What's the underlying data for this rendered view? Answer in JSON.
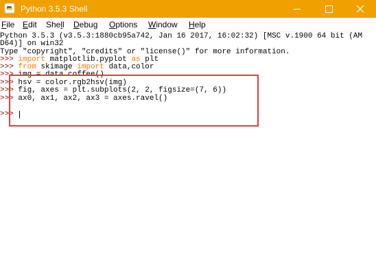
{
  "window": {
    "title": "Python 3.5.3 Shell",
    "accent_color": "#f0a000",
    "icons": [
      "python-icon",
      "minimize-icon",
      "maximize-icon",
      "close-icon"
    ]
  },
  "menu": {
    "file": {
      "u": "F",
      "rest": "ile"
    },
    "edit": {
      "u": "E",
      "rest": "dit"
    },
    "shell": {
      "pre": "She",
      "u": "l",
      "rest": "l"
    },
    "debug": {
      "u": "D",
      "rest": "ebug"
    },
    "options": {
      "u": "O",
      "rest": "ptions"
    },
    "window": {
      "u": "W",
      "rest": "indow"
    },
    "help": {
      "u": "H",
      "rest": "elp"
    }
  },
  "shell": {
    "banner1": "Python 3.5.3 (v3.5.3:1880cb95a742, Jan 16 2017, 16:02:32) [MSC v.1900 64 bit (AM",
    "banner2": "D64)] on win32",
    "banner3": "Type \"copyright\", \"credits\" or \"license()\" for more information.",
    "prompt": ">>> ",
    "cmd1_kw1": "import",
    "cmd1_rest1": " matplotlib.pyplot ",
    "cmd1_kw2": "as",
    "cmd1_rest2": " plt",
    "cmd2_kw1": "from",
    "cmd2_rest1": " skimage ",
    "cmd2_kw2": "import",
    "cmd2_rest2": " data,color",
    "cmd3": "img = data.coffee()",
    "cmd4": "hsv = color.rgb2hsv(img)",
    "cmd5": "fig, axes = plt.subplots(2, 2, figsize=(7, 6))",
    "cmd6": "ax0, ax1, ax2, ax3 = axes.ravel()"
  },
  "annotation_color": "#e33b3b"
}
